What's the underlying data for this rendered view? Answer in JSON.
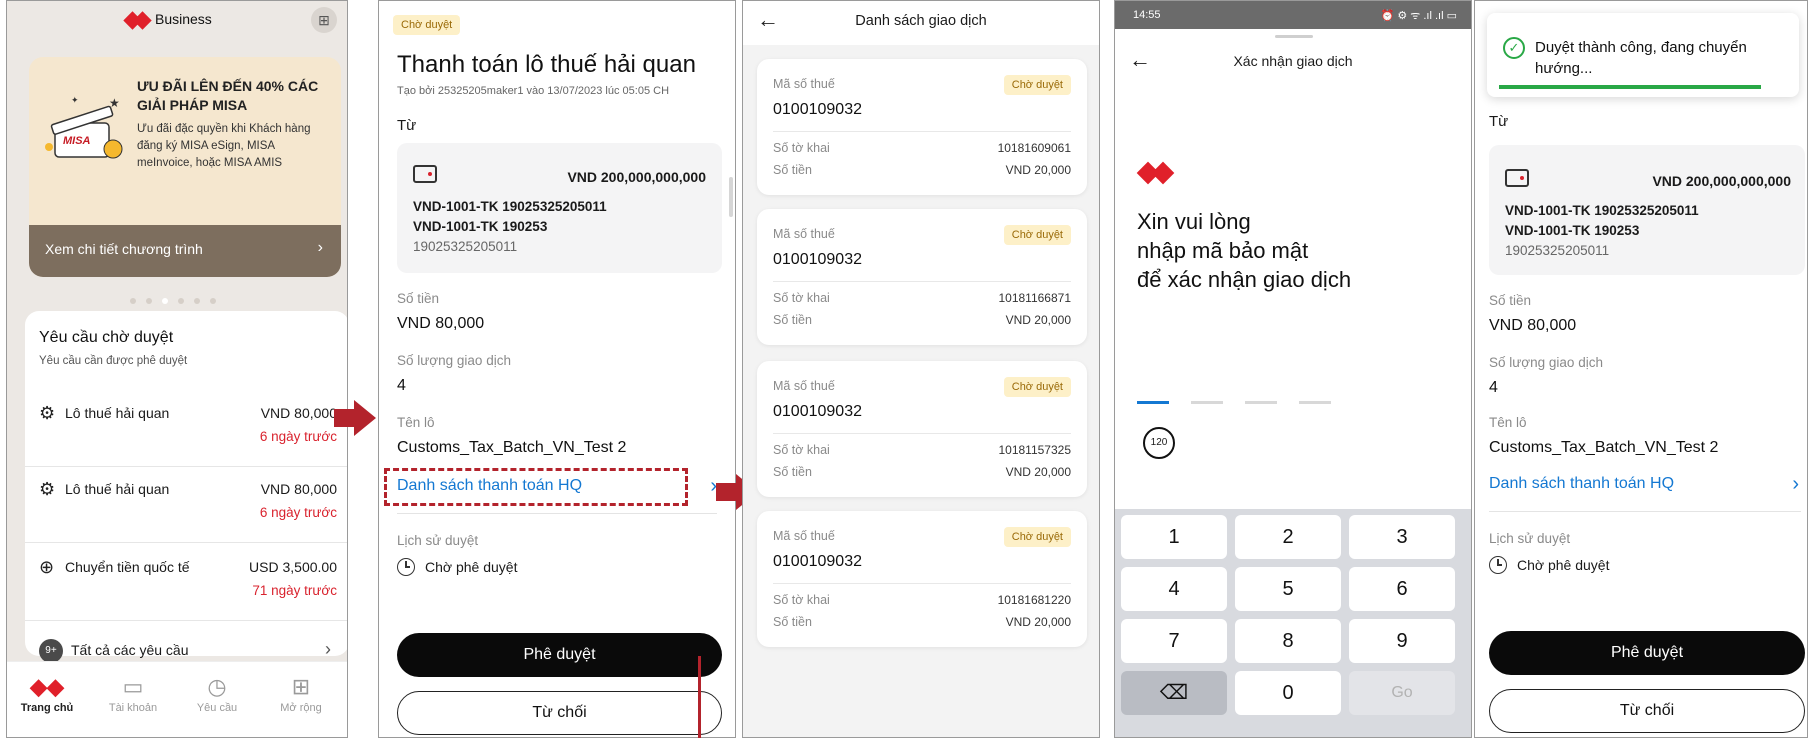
{
  "colors": {
    "brand_red": "#e0202a",
    "link_blue": "#1478d2",
    "pending_bg": "#fdf0c8",
    "success_green": "#29a846",
    "annotation_red": "#b3232c"
  },
  "home": {
    "app_title": "Business",
    "qr_icon": "qr-code-icon",
    "banner": {
      "title": "ƯU ĐÃI LÊN ĐẾN 40% CÁC GIẢI PHÁP MISA",
      "desc": "Ưu đãi đặc quyền khi Khách hàng đăng ký MISA eSign, MISA meInvoice, hoặc MISA AMIS",
      "art_label": "MISA",
      "cta": "Xem chi tiết chương trình"
    },
    "carousel_index": 3,
    "pending": {
      "title": "Yêu cầu chờ duyệt",
      "subtitle": "Yêu cầu cần được phê duyệt",
      "items": [
        {
          "icon": "customs-tax-icon",
          "name": "Lô thuế hải quan",
          "amount": "VND 80,000",
          "ago": "6 ngày trước"
        },
        {
          "icon": "customs-tax-icon",
          "name": "Lô thuế hải quan",
          "amount": "VND 80,000",
          "ago": "6 ngày trước"
        },
        {
          "icon": "globe-icon",
          "name": "Chuyển tiền quốc tế",
          "amount": "USD 3,500.00",
          "ago": "71 ngày trước"
        }
      ],
      "badge": "9+",
      "all_label": "Tất cả các yêu cầu"
    },
    "tabs": [
      {
        "label": "Trang chủ",
        "icon": "home-logo-icon"
      },
      {
        "label": "Tài khoản",
        "icon": "wallet-icon"
      },
      {
        "label": "Yêu cầu",
        "icon": "clock-icon"
      },
      {
        "label": "Mở rộng",
        "icon": "grid-icon"
      }
    ]
  },
  "detail": {
    "status": "Chờ duyệt",
    "title": "Thanh toán lô thuế hải quan",
    "created": "Tạo bởi 25325205maker1 vào 13/07/2023 lúc 05:05 CH",
    "from_label": "Từ",
    "account_balance": "VND 200,000,000,000",
    "account_line1": "VND-1001-TK 19025325205011",
    "account_line2": "VND-1001-TK 190253",
    "account_number": "19025325205011",
    "amount_label": "Số tiền",
    "amount": "VND 80,000",
    "count_label": "Số lượng giao dịch",
    "count": "4",
    "batch_label": "Tên lô",
    "batch_name": "Customs_Tax_Batch_VN_Test 2",
    "list_link": "Danh sách thanh toán HQ",
    "history_label": "Lịch sử duyệt",
    "history_status": "Chờ phê duyệt",
    "approve": "Phê duyệt",
    "reject": "Từ chối"
  },
  "txlist": {
    "title": "Danh sách giao dịch",
    "tax_code_label": "Mã số thuế",
    "declaration_label": "Số tờ khai",
    "amount_label": "Số tiền",
    "status": "Chờ duyệt",
    "items": [
      {
        "tax_code": "0100109032",
        "declaration": "10181609061",
        "amount": "VND 20,000"
      },
      {
        "tax_code": "0100109032",
        "declaration": "10181166871",
        "amount": "VND 20,000"
      },
      {
        "tax_code": "0100109032",
        "declaration": "10181157325",
        "amount": "VND 20,000"
      },
      {
        "tax_code": "0100109032",
        "declaration": "10181681220",
        "amount": "VND 20,000"
      }
    ]
  },
  "confirm": {
    "time": "14:55",
    "status_icons": "⏰ ⚙ ᯤ .ıl .ıl ▭",
    "title": "Xác nhận giao dịch",
    "prompt_line1": "Xin vui lòng",
    "prompt_line2": "nhập mã bảo mật",
    "prompt_line3": "để xác nhận giao dịch",
    "otp_length": 4,
    "countdown": "120",
    "keys": [
      "1",
      "2",
      "3",
      "4",
      "5",
      "6",
      "7",
      "8",
      "9",
      "⌫",
      "0",
      "Go"
    ]
  },
  "success": {
    "toast": "Duyệt thành công, đang chuyển hướng..."
  }
}
